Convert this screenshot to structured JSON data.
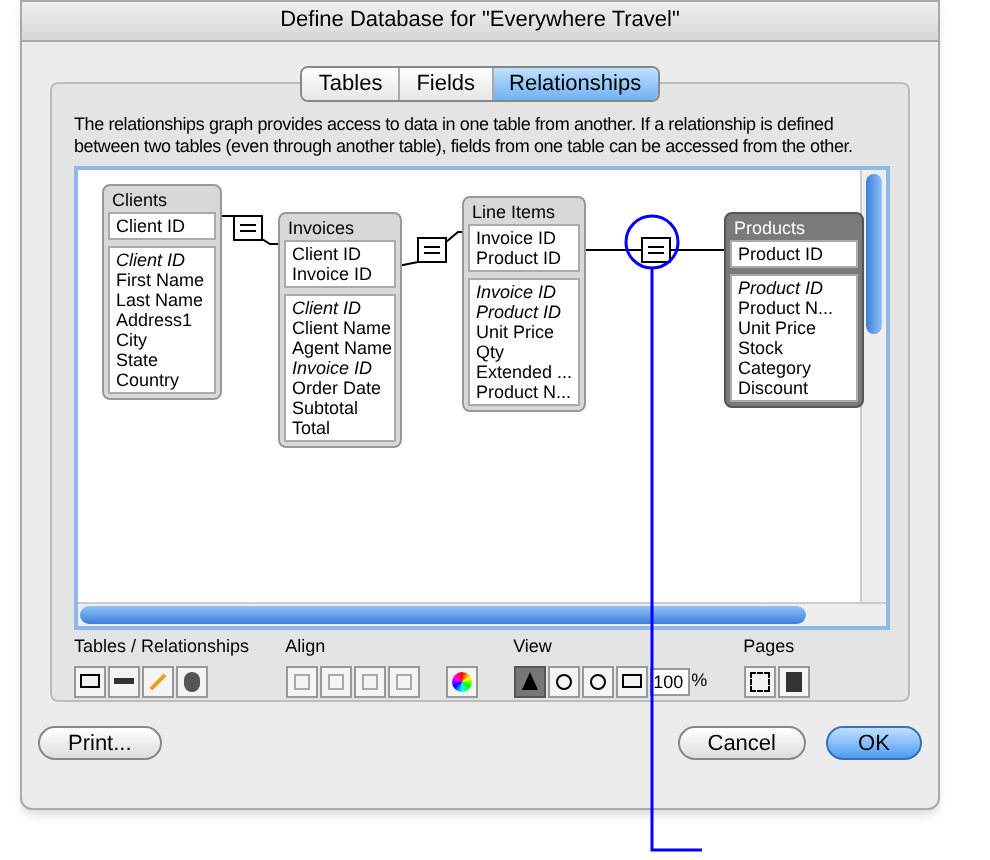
{
  "window": {
    "title": "Define Database for \"Everywhere Travel\""
  },
  "tabs": [
    {
      "label": "Tables",
      "selected": false
    },
    {
      "label": "Fields",
      "selected": false
    },
    {
      "label": "Relationships",
      "selected": true
    }
  ],
  "description": "The relationships graph provides access to data in one table from another. If a relationship is defined between two tables (even through another table), fields from one table can be accessed from the other.",
  "tables": [
    {
      "name": "Clients",
      "selected": false,
      "keys": [
        "Client ID"
      ],
      "fields": [
        {
          "label": "Client ID",
          "italic": true
        },
        {
          "label": "First Name",
          "italic": false
        },
        {
          "label": "Last Name",
          "italic": false
        },
        {
          "label": "Address1",
          "italic": false
        },
        {
          "label": "City",
          "italic": false
        },
        {
          "label": "State",
          "italic": false
        },
        {
          "label": "Country",
          "italic": false
        }
      ]
    },
    {
      "name": "Invoices",
      "selected": false,
      "keys": [
        "Client ID",
        "Invoice ID"
      ],
      "fields": [
        {
          "label": "Client ID",
          "italic": true
        },
        {
          "label": "Client Name",
          "italic": false
        },
        {
          "label": "Agent Name",
          "italic": false
        },
        {
          "label": "Invoice ID",
          "italic": true
        },
        {
          "label": "Order Date",
          "italic": false
        },
        {
          "label": "Subtotal",
          "italic": false
        },
        {
          "label": "Total",
          "italic": false
        }
      ]
    },
    {
      "name": "Line Items",
      "selected": false,
      "keys": [
        "Invoice ID",
        "Product ID"
      ],
      "fields": [
        {
          "label": "Invoice ID",
          "italic": true
        },
        {
          "label": "Product ID",
          "italic": true
        },
        {
          "label": "Unit Price",
          "italic": false
        },
        {
          "label": "Qty",
          "italic": false
        },
        {
          "label": "Extended ...",
          "italic": false
        },
        {
          "label": "Product N...",
          "italic": false
        }
      ]
    },
    {
      "name": "Products",
      "selected": true,
      "keys": [
        "Product ID"
      ],
      "fields": [
        {
          "label": "Product ID",
          "italic": true
        },
        {
          "label": "Product N...",
          "italic": false
        },
        {
          "label": "Unit Price",
          "italic": false
        },
        {
          "label": "Stock",
          "italic": false
        },
        {
          "label": "Category",
          "italic": false
        },
        {
          "label": "Discount",
          "italic": false
        }
      ]
    }
  ],
  "toolbar": {
    "tables_label": "Tables / Relationships",
    "align_label": "Align",
    "view_label": "View",
    "zoom": "100",
    "zoom_unit": "%",
    "pages_label": "Pages"
  },
  "buttons": {
    "print": "Print...",
    "cancel": "Cancel",
    "ok": "OK"
  }
}
